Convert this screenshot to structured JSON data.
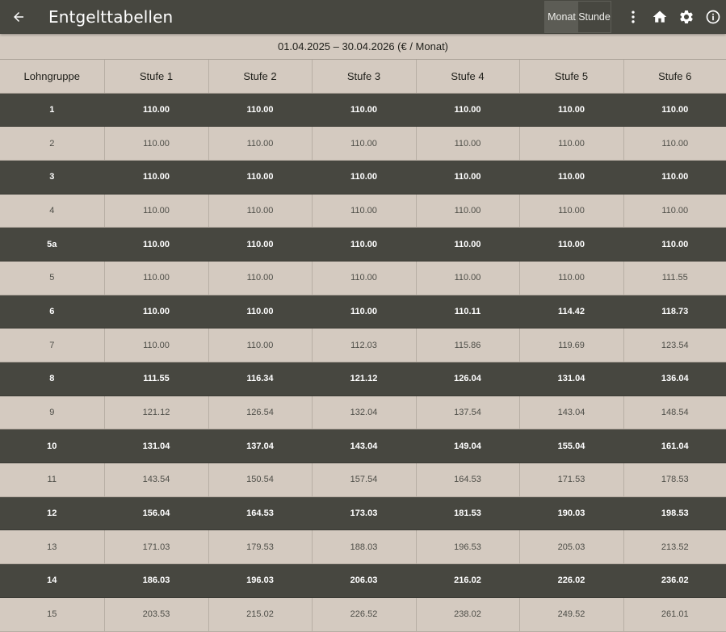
{
  "appbar": {
    "title": "Entgelttabellen",
    "toggle": {
      "monat_label": "Monat",
      "stunde_label": "Stunde",
      "selected": "Monat"
    },
    "icons": [
      "back-arrow-icon",
      "more-vert-icon",
      "home-icon",
      "settings-icon",
      "info-icon"
    ]
  },
  "period_label": "01.04.2025 – 30.04.2026 (€ / Monat)",
  "table": {
    "headers": [
      "Lohngruppe",
      "Stufe 1",
      "Stufe 2",
      "Stufe 3",
      "Stufe 4",
      "Stufe 5",
      "Stufe 6"
    ],
    "rows": [
      [
        "1",
        "110.00",
        "110.00",
        "110.00",
        "110.00",
        "110.00",
        "110.00"
      ],
      [
        "2",
        "110.00",
        "110.00",
        "110.00",
        "110.00",
        "110.00",
        "110.00"
      ],
      [
        "3",
        "110.00",
        "110.00",
        "110.00",
        "110.00",
        "110.00",
        "110.00"
      ],
      [
        "4",
        "110.00",
        "110.00",
        "110.00",
        "110.00",
        "110.00",
        "110.00"
      ],
      [
        "5a",
        "110.00",
        "110.00",
        "110.00",
        "110.00",
        "110.00",
        "110.00"
      ],
      [
        "5",
        "110.00",
        "110.00",
        "110.00",
        "110.00",
        "110.00",
        "111.55"
      ],
      [
        "6",
        "110.00",
        "110.00",
        "110.00",
        "110.11",
        "114.42",
        "118.73"
      ],
      [
        "7",
        "110.00",
        "110.00",
        "112.03",
        "115.86",
        "119.69",
        "123.54"
      ],
      [
        "8",
        "111.55",
        "116.34",
        "121.12",
        "126.04",
        "131.04",
        "136.04"
      ],
      [
        "9",
        "121.12",
        "126.54",
        "132.04",
        "137.54",
        "143.04",
        "148.54"
      ],
      [
        "10",
        "131.04",
        "137.04",
        "143.04",
        "149.04",
        "155.04",
        "161.04"
      ],
      [
        "11",
        "143.54",
        "150.54",
        "157.54",
        "164.53",
        "171.53",
        "178.53"
      ],
      [
        "12",
        "156.04",
        "164.53",
        "173.03",
        "181.53",
        "190.03",
        "198.53"
      ],
      [
        "13",
        "171.03",
        "179.53",
        "188.03",
        "196.53",
        "205.03",
        "213.52"
      ],
      [
        "14",
        "186.03",
        "196.03",
        "206.03",
        "216.02",
        "226.02",
        "236.02"
      ],
      [
        "15",
        "203.53",
        "215.02",
        "226.52",
        "238.02",
        "249.52",
        "261.01"
      ]
    ]
  },
  "colors": {
    "appbar": "#474740",
    "dark_row": "#474740",
    "light_row": "#d4cac0"
  }
}
